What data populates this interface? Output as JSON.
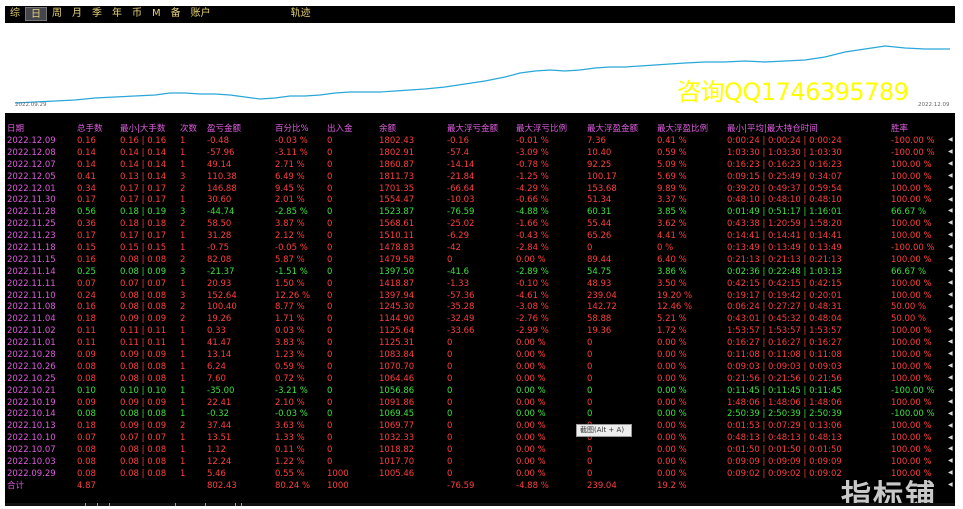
{
  "tabs": [
    "综",
    "日",
    "周",
    "月",
    "季",
    "年",
    "币",
    "M",
    "备",
    "账户",
    "轨迹"
  ],
  "active_tab": "日",
  "chart": {
    "start_label": "2022.09.29",
    "end_label": "2022.12.09",
    "line_color": "#2aa7d8"
  },
  "watermark": "咨询QQ1746395789",
  "logo": "指标铺",
  "tooltip": "截图(Alt + A)",
  "headers": [
    "日期",
    "总手数",
    "最小|大手数",
    "次数",
    "盈亏金额",
    "百分比%",
    "出入金",
    "余额",
    "最大浮亏金额",
    "最大浮亏比例",
    "最大浮盈金额",
    "最大浮盈比例",
    "最小|平均|最大持仓时间",
    "胜率"
  ],
  "rows": [
    {
      "c": "r",
      "v": [
        "2022.12.09",
        "0.16",
        "0.16 | 0.16",
        "1",
        "-0.48",
        "-0.03 %",
        "0",
        "1802.43",
        "-0.16",
        "-0.01 %",
        "7.36",
        "0.41 %",
        "0:00:24 | 0:00:24 | 0:00:24",
        "-100.00 %"
      ]
    },
    {
      "c": "r",
      "v": [
        "2022.12.08",
        "0.14",
        "0.14 | 0.14",
        "1",
        "-57.96",
        "-3.11 %",
        "0",
        "1802.91",
        "-57.4",
        "-3.09 %",
        "10.40",
        "0.59 %",
        "1:03:30 | 1:03:30 | 1:03:30",
        "-100.00 %"
      ]
    },
    {
      "c": "r",
      "v": [
        "2022.12.07",
        "0.14",
        "0.14 | 0.14",
        "1",
        "49.14",
        "2.71 %",
        "0",
        "1860.87",
        "-14.14",
        "-0.78 %",
        "92.25",
        "5.09 %",
        "0:16:23 | 0:16:23 | 0:16:23",
        "100.00 %"
      ]
    },
    {
      "c": "r",
      "v": [
        "2022.12.05",
        "0.41",
        "0.13 | 0.14",
        "3",
        "110.38",
        "6.49 %",
        "0",
        "1811.73",
        "-21.84",
        "-1.25 %",
        "100.17",
        "5.69 %",
        "0:09:15 | 0:25:49 | 0:34:07",
        "100.00 %"
      ]
    },
    {
      "c": "r",
      "v": [
        "2022.12.01",
        "0.34",
        "0.17 | 0.17",
        "2",
        "146.88",
        "9.45 %",
        "0",
        "1701.35",
        "-66.64",
        "-4.29 %",
        "153.68",
        "9.89 %",
        "0:39:20 | 0:49:37 | 0:59:54",
        "100.00 %"
      ]
    },
    {
      "c": "r",
      "v": [
        "2022.11.30",
        "0.17",
        "0.17 | 0.17",
        "1",
        "30.60",
        "2.01 %",
        "0",
        "1554.47",
        "-10.03",
        "-0.66 %",
        "51.34",
        "3.37 %",
        "0:48:10 | 0:48:10 | 0:48:10",
        "100.00 %"
      ]
    },
    {
      "c": "g",
      "v": [
        "2022.11.28",
        "0.56",
        "0.18 | 0.19",
        "3",
        "-44.74",
        "-2.85 %",
        "0",
        "1523.87",
        "-76.59",
        "-4.88 %",
        "60.31",
        "3.85 %",
        "0:01:49 | 0:51:17 | 1:16:01",
        "66.67 %"
      ]
    },
    {
      "c": "r",
      "v": [
        "2022.11.25",
        "0.36",
        "0.18 | 0.18",
        "2",
        "58.50",
        "3.87 %",
        "0",
        "1568.61",
        "-25.02",
        "-1.66 %",
        "55.44",
        "3.62 %",
        "0:43:38 | 1:20:59 | 1:58:20",
        "100.00 %"
      ]
    },
    {
      "c": "r",
      "v": [
        "2022.11.23",
        "0.17",
        "0.17 | 0.17",
        "1",
        "31.28",
        "2.12 %",
        "0",
        "1510.11",
        "-6.29",
        "-0.43 %",
        "65.26",
        "4.41 %",
        "0:14:41 | 0:14:41 | 0:14:41",
        "100.00 %"
      ]
    },
    {
      "c": "r",
      "v": [
        "2022.11.18",
        "0.15",
        "0.15 | 0.15",
        "1",
        "-0.75",
        "-0.05 %",
        "0",
        "1478.83",
        "-42",
        "-2.84 %",
        "0",
        "0 %",
        "0:13:49 | 0:13:49 | 0:13:49",
        "-100.00 %"
      ]
    },
    {
      "c": "r",
      "v": [
        "2022.11.15",
        "0.16",
        "0.08 | 0.08",
        "2",
        "82.08",
        "5.87 %",
        "0",
        "1479.58",
        "0",
        "0.00 %",
        "89.44",
        "6.40 %",
        "0:21:13 | 0:21:13 | 0:21:13",
        "100.00 %"
      ]
    },
    {
      "c": "g",
      "v": [
        "2022.11.14",
        "0.25",
        "0.08 | 0.09",
        "3",
        "-21.37",
        "-1.51 %",
        "0",
        "1397.50",
        "-41.6",
        "-2.89 %",
        "54.75",
        "3.86 %",
        "0:02:36 | 0:22:48 | 1:03:13",
        "66.67 %"
      ]
    },
    {
      "c": "r",
      "v": [
        "2022.11.11",
        "0.07",
        "0.07 | 0.07",
        "1",
        "20.93",
        "1.50 %",
        "0",
        "1418.87",
        "-1.33",
        "-0.10 %",
        "48.93",
        "3.50 %",
        "0:42:15 | 0:42:15 | 0:42:15",
        "100.00 %"
      ]
    },
    {
      "c": "r",
      "v": [
        "2022.11.10",
        "0.24",
        "0.08 | 0.08",
        "3",
        "152.64",
        "12.26 %",
        "0",
        "1397.94",
        "-57.36",
        "-4.61 %",
        "239.04",
        "19.20 %",
        "0:19:17 | 0:19:42 | 0:20:01",
        "100.00 %"
      ]
    },
    {
      "c": "r",
      "v": [
        "2022.11.08",
        "0.16",
        "0.08 | 0.08",
        "2",
        "100.40",
        "8.77 %",
        "0",
        "1245.30",
        "-35.28",
        "-3.08 %",
        "142.72",
        "12.46 %",
        "0:06:24 | 0:27:27 | 0:48:31",
        "50.00 %"
      ]
    },
    {
      "c": "r",
      "v": [
        "2022.11.04",
        "0.18",
        "0.09 | 0.09",
        "2",
        "19.26",
        "1.71 %",
        "0",
        "1144.90",
        "-32.49",
        "-2.76 %",
        "58.88",
        "5.21 %",
        "0:43:01 | 0:45:32 | 0:48:04",
        "50.00 %"
      ]
    },
    {
      "c": "r",
      "v": [
        "2022.11.02",
        "0.11",
        "0.11 | 0.11",
        "1",
        "0.33",
        "0.03 %",
        "0",
        "1125.64",
        "-33.66",
        "-2.99 %",
        "19.36",
        "1.72 %",
        "1:53:57 | 1:53:57 | 1:53:57",
        "100.00 %"
      ]
    },
    {
      "c": "r",
      "v": [
        "2022.11.01",
        "0.11",
        "0.11 | 0.11",
        "1",
        "41.47",
        "3.83 %",
        "0",
        "1125.31",
        "0",
        "0.00 %",
        "0",
        "0.00 %",
        "0:16:27 | 0:16:27 | 0:16:27",
        "100.00 %"
      ]
    },
    {
      "c": "r",
      "v": [
        "2022.10.28",
        "0.09",
        "0.09 | 0.09",
        "1",
        "13.14",
        "1.23 %",
        "0",
        "1083.84",
        "0",
        "0.00 %",
        "0",
        "0.00 %",
        "0:11:08 | 0:11:08 | 0:11:08",
        "100.00 %"
      ]
    },
    {
      "c": "r",
      "v": [
        "2022.10.26",
        "0.08",
        "0.08 | 0.08",
        "1",
        "6.24",
        "0.59 %",
        "0",
        "1070.70",
        "0",
        "0.00 %",
        "0",
        "0.00 %",
        "0:09:03 | 0:09:03 | 0:09:03",
        "100.00 %"
      ]
    },
    {
      "c": "r",
      "v": [
        "2022.10.25",
        "0.08",
        "0.08 | 0.08",
        "1",
        "7.60",
        "0.72 %",
        "0",
        "1064.46",
        "0",
        "0.00 %",
        "0",
        "0.00 %",
        "0:21:56 | 0:21:56 | 0:21:56",
        "100.00 %"
      ]
    },
    {
      "c": "g",
      "v": [
        "2022.10.21",
        "0.10",
        "0.10 | 0.10",
        "1",
        "-35.00",
        "-3.21 %",
        "0",
        "1056.86",
        "0",
        "0.00 %",
        "0",
        "0.00 %",
        "0:11:45 | 0:11:45 | 0:11:45",
        "-100.00 %"
      ]
    },
    {
      "c": "r",
      "v": [
        "2022.10.19",
        "0.09",
        "0.09 | 0.09",
        "1",
        "22.41",
        "2.10 %",
        "0",
        "1091.86",
        "0",
        "0.00 %",
        "0",
        "0.00 %",
        "1:48:06 | 1:48:06 | 1:48:06",
        "100.00 %"
      ]
    },
    {
      "c": "g",
      "v": [
        "2022.10.14",
        "0.08",
        "0.08 | 0.08",
        "1",
        "-0.32",
        "-0.03 %",
        "0",
        "1069.45",
        "0",
        "0.00 %",
        "0",
        "0.00 %",
        "2:50:39 | 2:50:39 | 2:50:39",
        "-100.00 %"
      ]
    },
    {
      "c": "r",
      "v": [
        "2022.10.13",
        "0.18",
        "0.09 | 0.09",
        "2",
        "37.44",
        "3.63 %",
        "0",
        "1069.77",
        "0",
        "0.00 %",
        "0",
        "0.00 %",
        "0:01:53 | 0:07:29 | 0:13:06",
        "100.00 %"
      ]
    },
    {
      "c": "r",
      "v": [
        "2022.10.10",
        "0.07",
        "0.07 | 0.07",
        "1",
        "13.51",
        "1.33 %",
        "0",
        "1032.33",
        "0",
        "0.00 %",
        "0",
        "0.00 %",
        "0:48:13 | 0:48:13 | 0:48:13",
        "100.00 %"
      ]
    },
    {
      "c": "r",
      "v": [
        "2022.10.07",
        "0.08",
        "0.08 | 0.08",
        "1",
        "1.12",
        "0.11 %",
        "0",
        "1018.82",
        "0",
        "0.00 %",
        "0",
        "0.00 %",
        "0:01:50 | 0:01:50 | 0:01:50",
        "100.00 %"
      ]
    },
    {
      "c": "r",
      "v": [
        "2022.10.03",
        "0.08",
        "0.08 | 0.08",
        "1",
        "12.24",
        "1.22 %",
        "0",
        "1017.70",
        "0",
        "0.00 %",
        "0",
        "0.00 %",
        "0:09:09 | 0:09:09 | 0:09:09",
        "100.00 %"
      ]
    },
    {
      "c": "r",
      "v": [
        "2022.09.29",
        "0.08",
        "0.08 | 0.08",
        "1",
        "5.46",
        "0.55 %",
        "1000",
        "1005.46",
        "0",
        "0.00 %",
        "0",
        "0.00 %",
        "0:09:02 | 0:09:02 | 0:09:02",
        "100.00 %"
      ]
    }
  ],
  "total": [
    "合计",
    "4.87",
    "",
    "",
    "802.43",
    "80.24 %",
    "1000",
    "",
    "-76.59",
    "-4.88 %",
    "239.04",
    "19.2 %",
    "",
    ""
  ]
}
